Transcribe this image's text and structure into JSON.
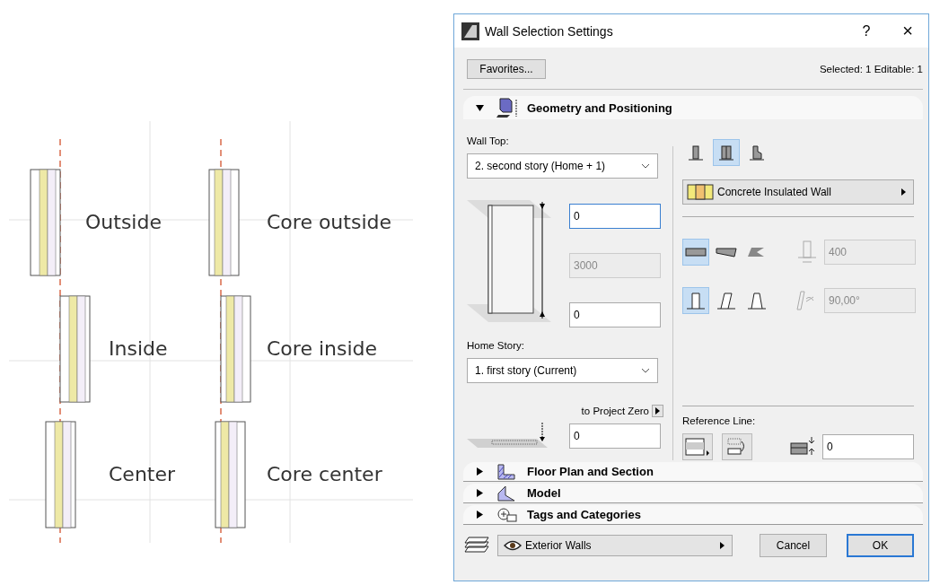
{
  "diagram": {
    "items": [
      {
        "label": "Outside",
        "kind": "outside",
        "core": false
      },
      {
        "label": "Core outside",
        "kind": "outside",
        "core": true
      },
      {
        "label": "Inside",
        "kind": "inside",
        "core": false
      },
      {
        "label": "Core inside",
        "kind": "inside",
        "core": true
      },
      {
        "label": "Center",
        "kind": "center",
        "core": false
      },
      {
        "label": "Core center",
        "kind": "center",
        "core": true
      }
    ]
  },
  "dialog": {
    "title": "Wall Selection Settings",
    "help": "?",
    "close": "×",
    "favorites": "Favorites...",
    "selection_info": "Selected: 1 Editable: 1",
    "sections": [
      {
        "title": "Geometry and Positioning",
        "kind": "geometry",
        "expanded": true
      },
      {
        "title": "Floor Plan and Section",
        "kind": "floorplan",
        "expanded": false
      },
      {
        "title": "Model",
        "kind": "model",
        "expanded": false
      },
      {
        "title": "Tags and Categories",
        "kind": "tags",
        "expanded": false
      }
    ],
    "geometry": {
      "wall_top_label": "Wall Top:",
      "wall_top": "2. second story (Home + 1)",
      "top_offset": {
        "value": "0",
        "disabled": false,
        "focused": true
      },
      "height": {
        "value": "3000",
        "disabled": true,
        "focused": false
      },
      "bottom_offset": {
        "value": "0",
        "disabled": false,
        "focused": false
      },
      "home_story_label": "Home Story:",
      "home_story": "1. first story (Current)",
      "project_zero_label": "to Project Zero",
      "project_zero": {
        "value": "0",
        "disabled": false,
        "focused": false
      },
      "structure": [
        {
          "kind": "basic",
          "selected": false
        },
        {
          "kind": "composite",
          "selected": true
        },
        {
          "kind": "profile",
          "selected": false
        }
      ],
      "composite": "Concrete Insulated Wall",
      "shapes": [
        {
          "kind": "straight",
          "selected": true
        },
        {
          "kind": "trapezoid",
          "selected": false
        },
        {
          "kind": "polygonal",
          "selected": false
        }
      ],
      "thickness": {
        "value": "400",
        "disabled": true,
        "focused": false
      },
      "profiles": [
        {
          "kind": "vertical",
          "selected": true
        },
        {
          "kind": "slanted",
          "selected": false
        },
        {
          "kind": "double-slanted",
          "selected": false
        }
      ],
      "angle": {
        "value": "90,00°",
        "disabled": true,
        "focused": false
      },
      "reference_line_label": "Reference Line:",
      "reference_offset": {
        "value": "0",
        "disabled": false,
        "focused": false
      }
    },
    "footer": {
      "layer": "Exterior Walls",
      "cancel": "Cancel",
      "ok": "OK"
    }
  }
}
